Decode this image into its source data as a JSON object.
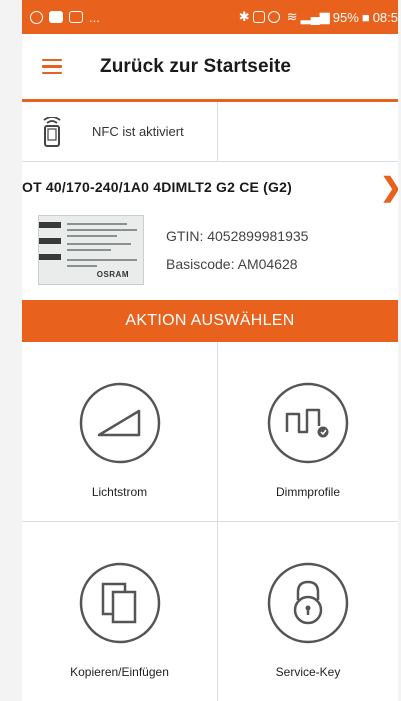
{
  "status_bar": {
    "left_icons": [
      "whatsapp-icon",
      "facebook-icon",
      "image-icon"
    ],
    "left_more": "...",
    "right_icons": [
      "bluetooth-icon",
      "nfc-icon",
      "mute-icon",
      "wifi-icon",
      "signal-icon"
    ],
    "battery": "95%",
    "time": "08:5",
    "battery_glyph": "■",
    "colors": {
      "background": "#e8621d",
      "text": "#ffffff"
    }
  },
  "app_bar": {
    "title": "Zurück zur Startseite",
    "menu_icon": "hamburger-menu-icon"
  },
  "nfc": {
    "label": "NFC ist aktiviert",
    "icon": "nfc-phone-icon"
  },
  "device": {
    "name": "OT 40/170-240/1A0 4DIMLT2 G2 CE  (G2)",
    "gtin": "GTIN: 4052899981935",
    "basiscode": "Basiscode: AM04628",
    "label_brand": "OSRAM",
    "chevron": "›"
  },
  "action_bar": {
    "label": "AKTION AUSWÄHLEN"
  },
  "tiles": [
    {
      "label": "Lichtstrom",
      "icon": "ramp-icon"
    },
    {
      "label": "Dimmprofile",
      "icon": "dimm-profile-icon"
    },
    {
      "label": "Kopieren/Einfügen",
      "icon": "copy-icon"
    },
    {
      "label": "Service-Key",
      "icon": "lock-icon"
    }
  ],
  "colors": {
    "accent": "#e8621d",
    "divider": "#dddddd",
    "icon_stroke": "#555555"
  }
}
